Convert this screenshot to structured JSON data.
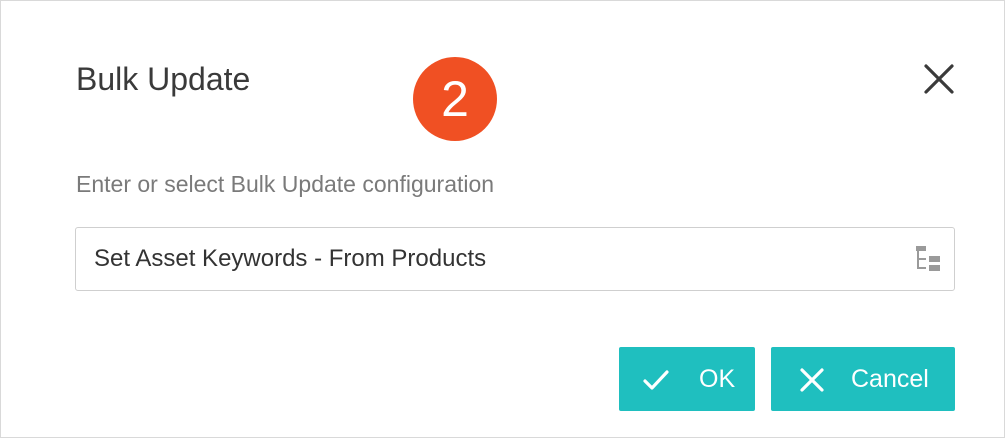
{
  "dialog": {
    "title": "Bulk Update",
    "step_number": "2",
    "prompt": "Enter or select Bulk Update configuration",
    "configuration_value": "Set Asset Keywords - From Products",
    "ok_label": "OK",
    "cancel_label": "Cancel"
  },
  "colors": {
    "accent": "#1fbfbf",
    "badge": "#f05023"
  },
  "icons": {
    "close": "close-icon",
    "tree": "tree-select-icon",
    "ok": "check-icon",
    "cancel": "x-icon"
  }
}
